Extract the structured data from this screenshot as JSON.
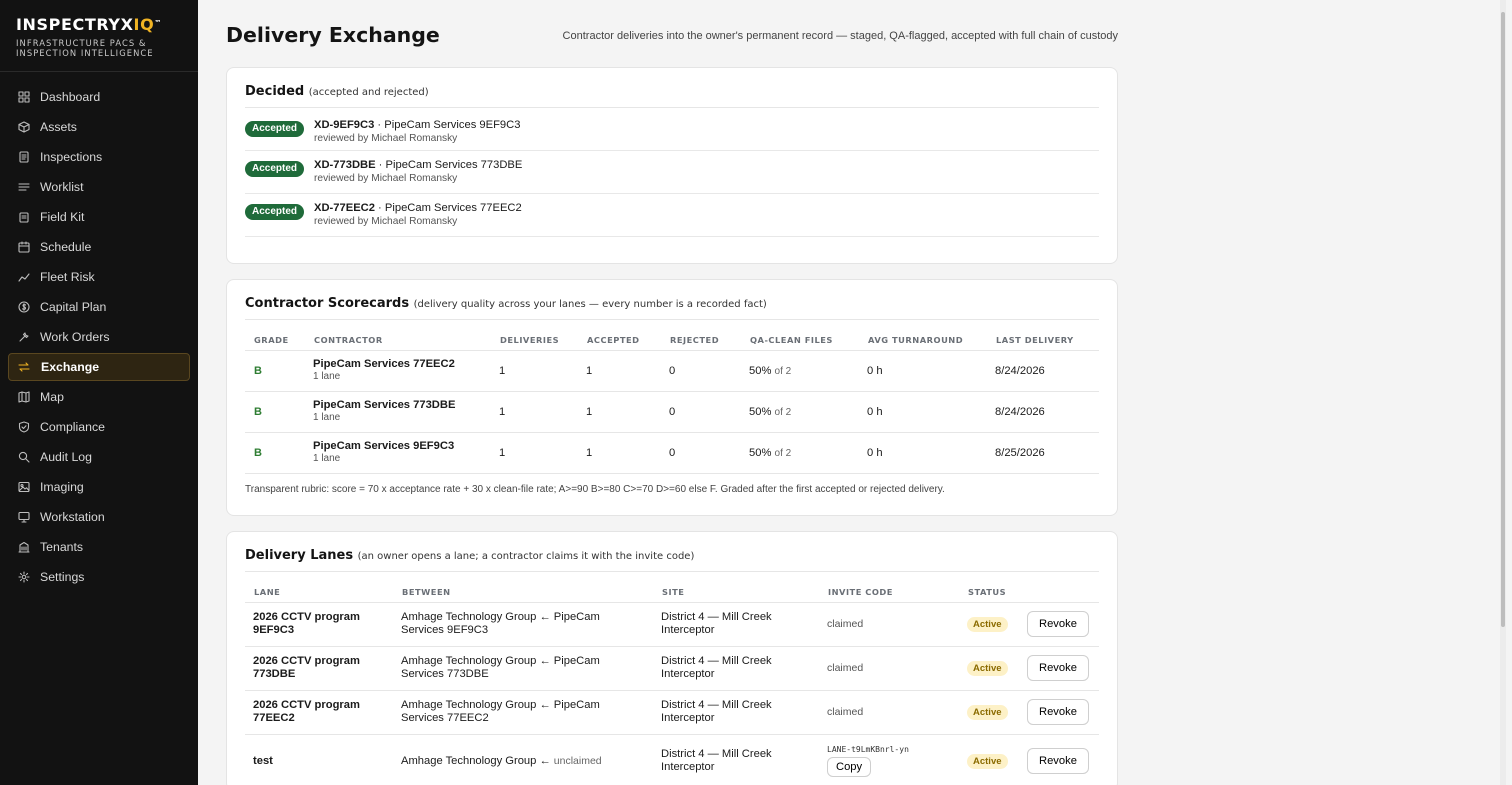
{
  "brand": {
    "name_main": "INSPECTRYX",
    "name_accent": "IQ",
    "trademark": "™",
    "tagline_1": "INFRASTRUCTURE PACS &",
    "tagline_2": "INSPECTION INTELLIGENCE"
  },
  "nav": {
    "items": [
      {
        "label": "Dashboard",
        "icon": "grid-icon"
      },
      {
        "label": "Assets",
        "icon": "cube-icon"
      },
      {
        "label": "Inspections",
        "icon": "document-icon"
      },
      {
        "label": "Worklist",
        "icon": "list-icon"
      },
      {
        "label": "Field Kit",
        "icon": "clipboard-icon"
      },
      {
        "label": "Schedule",
        "icon": "calendar-icon"
      },
      {
        "label": "Fleet Risk",
        "icon": "trend-icon"
      },
      {
        "label": "Capital Plan",
        "icon": "dollar-icon"
      },
      {
        "label": "Work Orders",
        "icon": "wrench-icon"
      },
      {
        "label": "Exchange",
        "icon": "swap-icon",
        "active": true
      },
      {
        "label": "Map",
        "icon": "map-icon"
      },
      {
        "label": "Compliance",
        "icon": "shield-icon"
      },
      {
        "label": "Audit Log",
        "icon": "search-icon"
      },
      {
        "label": "Imaging",
        "icon": "image-icon"
      },
      {
        "label": "Workstation",
        "icon": "monitor-icon"
      },
      {
        "label": "Tenants",
        "icon": "building-icon"
      },
      {
        "label": "Settings",
        "icon": "gear-icon"
      }
    ]
  },
  "page": {
    "title": "Delivery Exchange",
    "subtitle": "Contractor deliveries into the owner's permanent record — staged, QA-flagged, accepted with full chain of custody"
  },
  "decided": {
    "title": "Decided",
    "hint": "(accepted and rejected)",
    "rows": [
      {
        "status": "Accepted",
        "id": "XD-9EF9C3",
        "contractor": "PipeCam Services 9EF9C3",
        "reviewer": "reviewed by Michael Romansky"
      },
      {
        "status": "Accepted",
        "id": "XD-773DBE",
        "contractor": "PipeCam Services 773DBE",
        "reviewer": "reviewed by Michael Romansky"
      },
      {
        "status": "Accepted",
        "id": "XD-77EEC2",
        "contractor": "PipeCam Services 77EEC2",
        "reviewer": "reviewed by Michael Romansky"
      }
    ]
  },
  "scorecards": {
    "title": "Contractor Scorecards",
    "hint": "(delivery quality across your lanes — every number is a recorded fact)",
    "columns": [
      "GRADE",
      "CONTRACTOR",
      "DELIVERIES",
      "ACCEPTED",
      "REJECTED",
      "QA-CLEAN FILES",
      "AVG TURNAROUND",
      "LAST DELIVERY"
    ],
    "rows": [
      {
        "grade": "B",
        "name": "PipeCam Services 77EEC2",
        "lanes": "1 lane",
        "deliveries": "1",
        "accepted": "1",
        "rejected": "0",
        "qa_pct": "50%",
        "qa_of": "of 2",
        "turnaround": "0 h",
        "last": "8/24/2026"
      },
      {
        "grade": "B",
        "name": "PipeCam Services 773DBE",
        "lanes": "1 lane",
        "deliveries": "1",
        "accepted": "1",
        "rejected": "0",
        "qa_pct": "50%",
        "qa_of": "of 2",
        "turnaround": "0 h",
        "last": "8/24/2026"
      },
      {
        "grade": "B",
        "name": "PipeCam Services 9EF9C3",
        "lanes": "1 lane",
        "deliveries": "1",
        "accepted": "1",
        "rejected": "0",
        "qa_pct": "50%",
        "qa_of": "of 2",
        "turnaround": "0 h",
        "last": "8/25/2026"
      }
    ],
    "rubric": "Transparent rubric: score = 70 x acceptance rate + 30 x clean-file rate; A>=90 B>=80 C>=70 D>=60 else F. Graded after the first accepted or rejected delivery."
  },
  "lanes": {
    "title": "Delivery Lanes",
    "hint": "(an owner opens a lane; a contractor claims it with the invite code)",
    "columns": [
      "LANE",
      "BETWEEN",
      "SITE",
      "INVITE CODE",
      "STATUS",
      ""
    ],
    "rows": [
      {
        "lane_1": "2026 CCTV program",
        "lane_2": "9EF9C3",
        "between_1": "Amhage Technology Group ← PipeCam",
        "between_2": "Services 9EF9C3",
        "site_1": "District 4 — Mill Creek",
        "site_2": "Interceptor",
        "invite": "claimed",
        "status": "Active",
        "action": "Revoke"
      },
      {
        "lane_1": "2026 CCTV program",
        "lane_2": "773DBE",
        "between_1": "Amhage Technology Group ← PipeCam",
        "between_2": "Services 773DBE",
        "site_1": "District 4 — Mill Creek",
        "site_2": "Interceptor",
        "invite": "claimed",
        "status": "Active",
        "action": "Revoke"
      },
      {
        "lane_1": "2026 CCTV program",
        "lane_2": "77EEC2",
        "between_1": "Amhage Technology Group ← PipeCam",
        "between_2": "Services 77EEC2",
        "site_1": "District 4 — Mill Creek",
        "site_2": "Interceptor",
        "invite": "claimed",
        "status": "Active",
        "action": "Revoke"
      }
    ],
    "last_row": {
      "lane": "test",
      "between": "Amhage Technology Group ←",
      "between_unclaimed": "unclaimed",
      "site_1": "District 4 — Mill Creek",
      "site_2": "Interceptor",
      "invite_code": "LANE-t9LmKBnrl-yn",
      "copy": "Copy",
      "status": "Active",
      "action": "Revoke"
    }
  },
  "colors": {
    "sidebar_bg": "#121212",
    "brand_accent": "#f0b323",
    "accepted_badge": "#1f6b3a",
    "grade": "#2e7d32",
    "active_badge_bg": "#fdf1c7",
    "active_badge_fg": "#8b6b00"
  }
}
